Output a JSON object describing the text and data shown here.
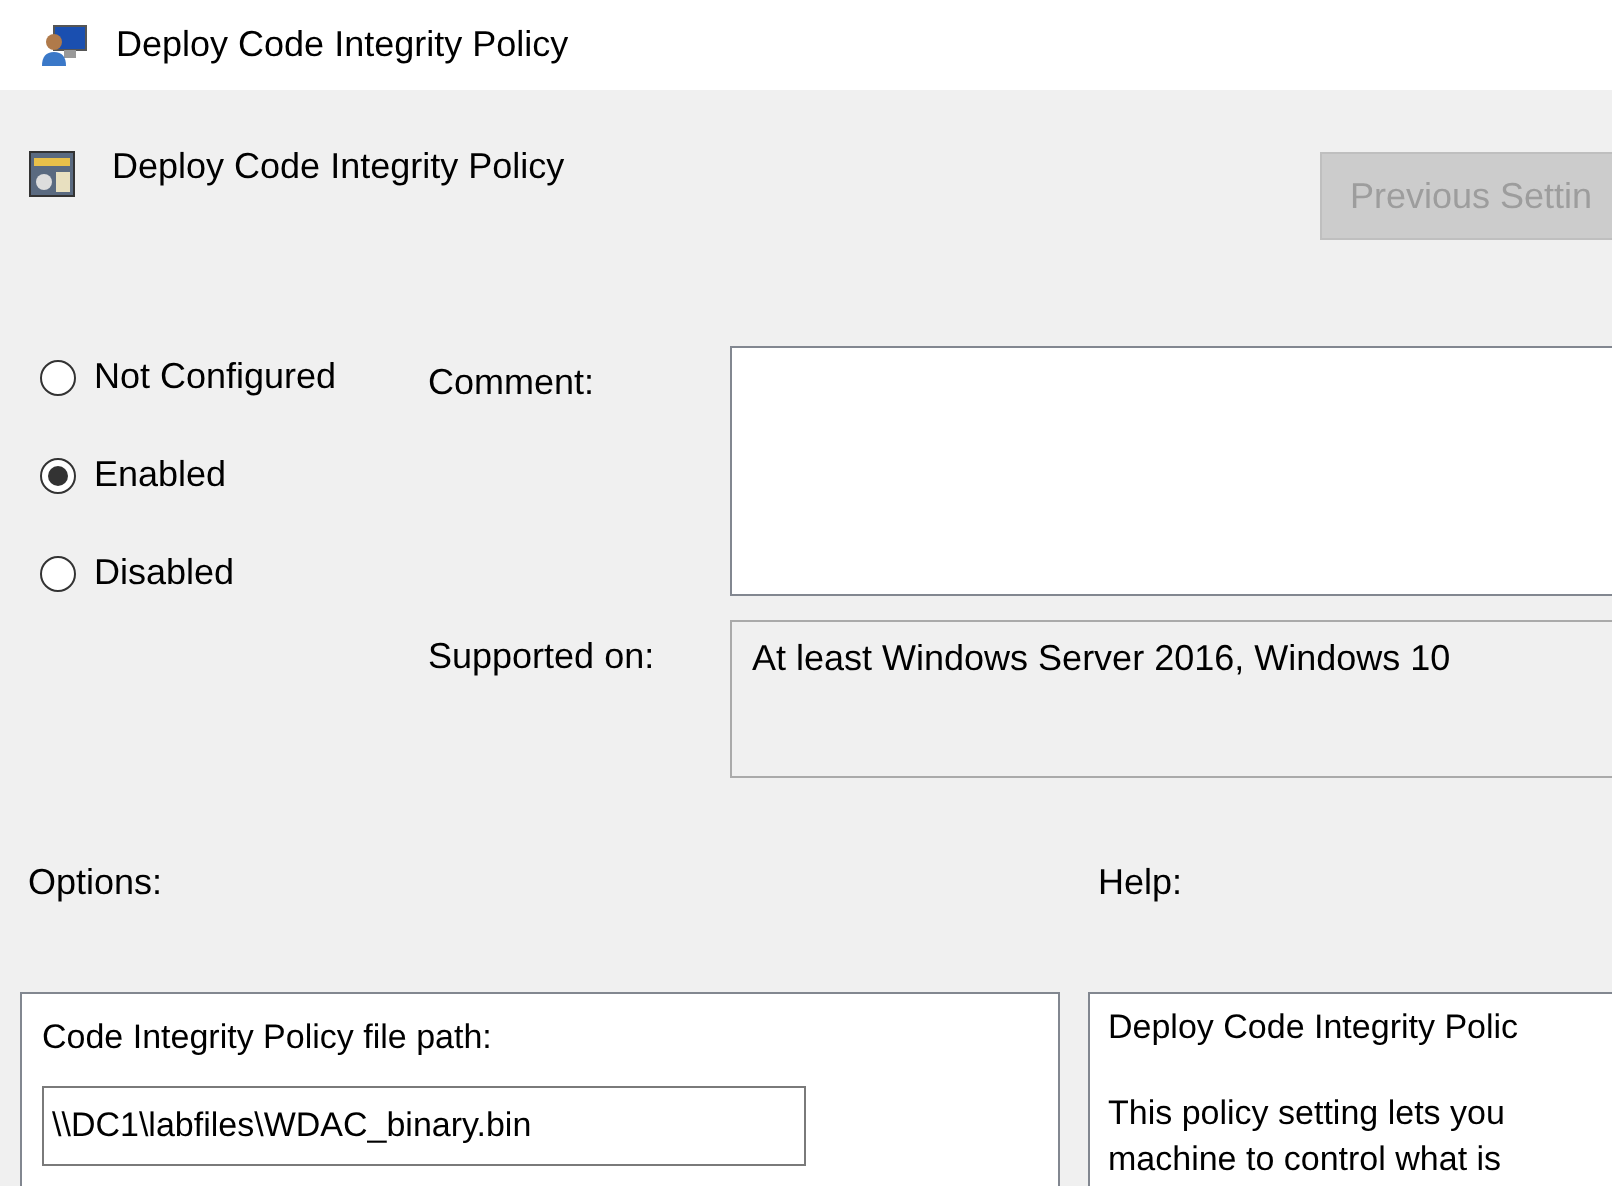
{
  "window": {
    "title": "Deploy Code Integrity Policy"
  },
  "header": {
    "title": "Deploy Code Integrity Policy",
    "buttons": [
      {
        "label": "Previous Settin",
        "disabled": true
      }
    ]
  },
  "state_options": [
    {
      "label": "Not Configured",
      "selected": false
    },
    {
      "label": "Enabled",
      "selected": true
    },
    {
      "label": "Disabled",
      "selected": false
    }
  ],
  "comment": {
    "label": "Comment:"
  },
  "supported_on": {
    "label": "Supported on:",
    "value": "At least Windows Server 2016, Windows 10"
  },
  "options": {
    "label": "Options:",
    "fields": [
      {
        "label": "Code Integrity Policy file path:",
        "value": "\\\\DC1\\labfiles\\WDAC_binary.bin"
      }
    ]
  },
  "help": {
    "label": "Help:",
    "paragraphs": [
      [
        "Deploy Code Integrity Polic"
      ],
      [
        "This policy setting lets you",
        "machine to control what is"
      ]
    ]
  }
}
